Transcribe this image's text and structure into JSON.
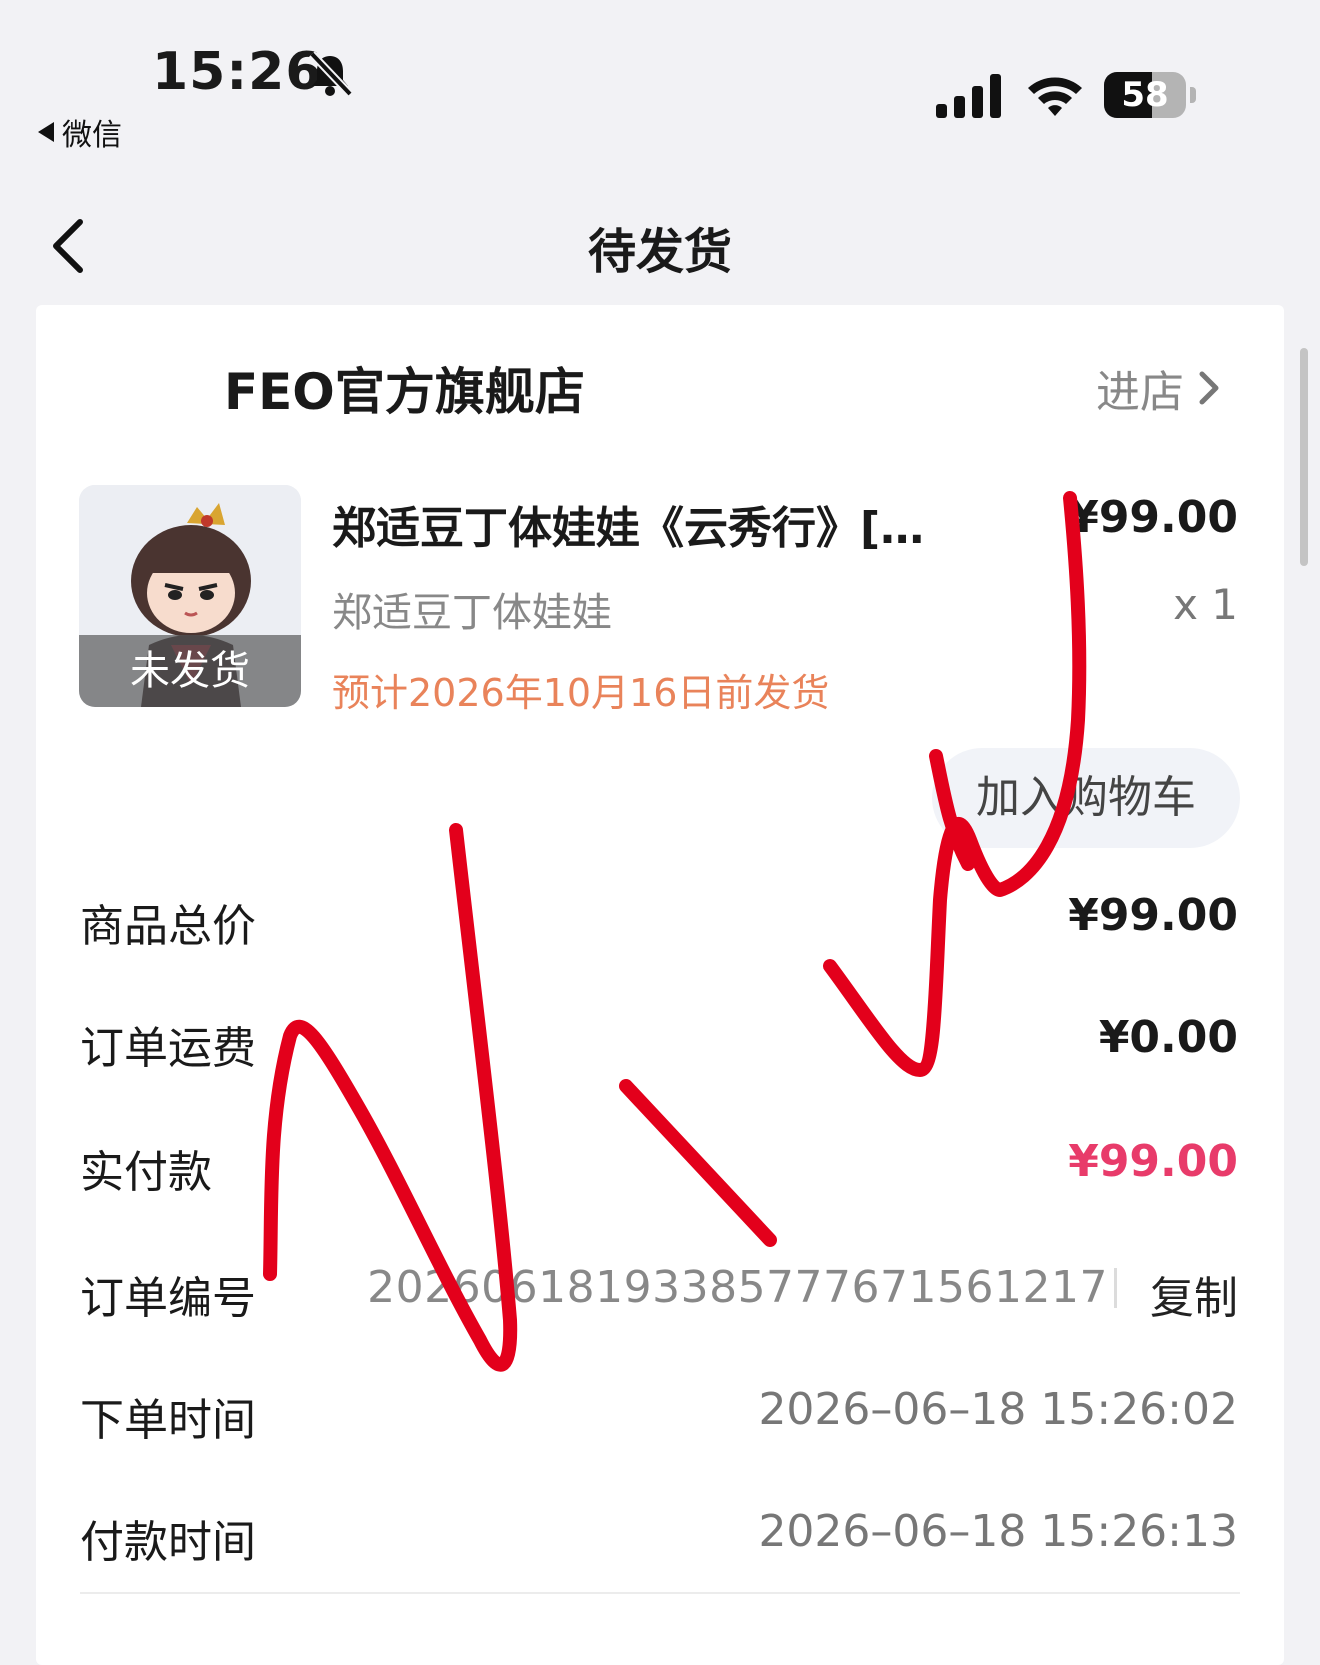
{
  "status_bar": {
    "time": "15:26",
    "back_app": "微信",
    "battery": 58
  },
  "nav": {
    "title": "待发货"
  },
  "store": {
    "name": "FEO官方旗舰店",
    "enter_label": "进店"
  },
  "product": {
    "title": "郑适豆丁体娃娃《云秀行》[…",
    "price": "¥99.00",
    "subtitle": "郑适豆丁体娃娃",
    "quantity": "x 1",
    "ship_estimate": "预计2026年10月16日前发货",
    "thumb_status": "未发货",
    "cart_button": "加入购物车"
  },
  "summary": {
    "goods_total_label": "商品总价",
    "goods_total": "¥99.00",
    "shipping_label": "订单运费",
    "shipping": "¥0.00",
    "paid_label": "实付款",
    "paid": "¥99.00",
    "order_no_label": "订单编号",
    "order_no": "2026061819338577767156121 7",
    "copy_label": "复制",
    "order_time_label": "下单时间",
    "order_time": "2026–06–18 15:26:02",
    "pay_time_label": "付款时间",
    "pay_time": "2026–06–18 15:26:13"
  },
  "colors": {
    "accent_pink": "#e83b6a",
    "ship_orange": "#e9835a",
    "ink_red": "#e3001b"
  },
  "icons": [
    "bell-slash-icon",
    "signal-icon",
    "wifi-icon",
    "battery-icon",
    "back-arrow-icon",
    "chevron-right-icon"
  ]
}
